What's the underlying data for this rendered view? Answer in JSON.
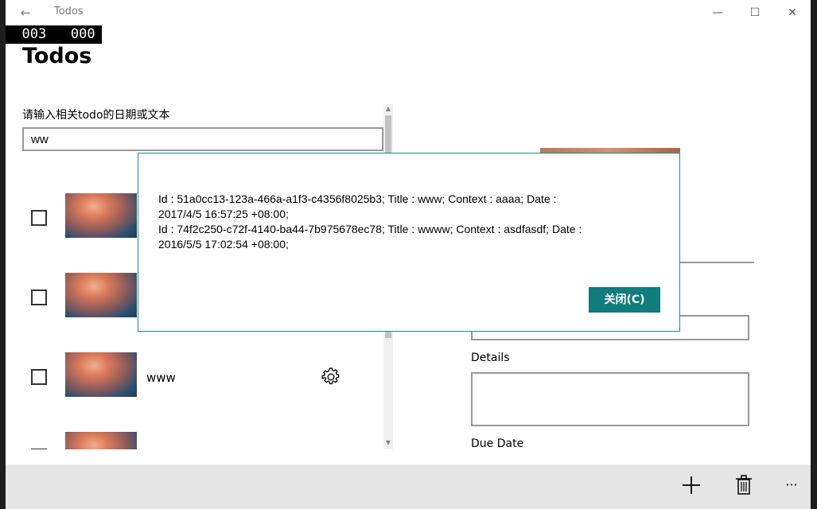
{
  "titlebar": {
    "app_title": "Todos",
    "back_glyph": "←",
    "minimize_glyph": "—",
    "maximize_glyph": "☐",
    "close_glyph": "✕"
  },
  "frame_counter": "  003   000",
  "page": {
    "title": "Todos",
    "search_label": "请输入相关todo的日期或文本",
    "search_value": "ww"
  },
  "todos": [
    {
      "text": "",
      "checked": false
    },
    {
      "text": "",
      "checked": false
    },
    {
      "text": "www",
      "checked": false
    },
    {
      "text": "",
      "checked": false
    }
  ],
  "detail": {
    "details_label": "Details",
    "due_date_label": "Due Date"
  },
  "dialog": {
    "content_lines": [
      "Id : 51a0cc13-123a-466a-a1f3-c4356f8025b3;  Title : www;  Context : aaaa;  Date :",
      "2017/4/5 16:57:25 +08:00;",
      "Id : 74f2c250-c72f-4140-ba44-7b975678ec78;  Title : wwww;  Context : asdfasdf;  Date :",
      "2016/5/5 17:02:54 +08:00;"
    ],
    "close_label": "关闭(C)"
  },
  "appbar": {
    "more_glyph": "···"
  },
  "colors": {
    "accent": "#107c7c",
    "dialog_border": "#1e8c8c",
    "appbar_bg": "#e6e6e6"
  }
}
